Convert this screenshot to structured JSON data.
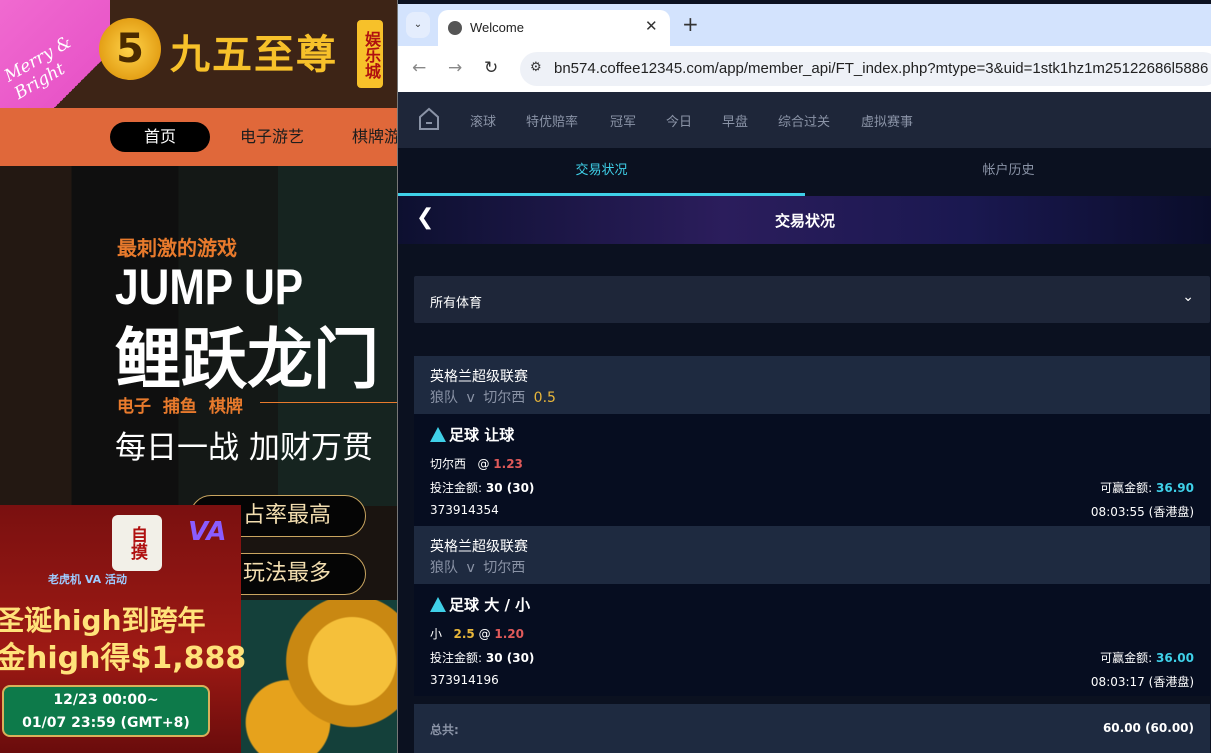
{
  "background_site": {
    "xmas_sticker": "Merry & Bright",
    "logo_mark": "5",
    "logo_text": "九五至尊",
    "logo_badge": "娱乐城",
    "nav": [
      "首页",
      "电子游艺",
      "棋牌游"
    ],
    "hero": {
      "tagline": "最刺激的游戏",
      "headline_en": "JUMP UP",
      "headline_cn": "鲤跃龙门",
      "categories": "电子 捕鱼 棋牌",
      "slogan": "每日一战 加财万贯",
      "pill1": "占率最高",
      "pill2": "玩法最多"
    },
    "promo": {
      "tile": "自摸",
      "brand": "VA",
      "subtitle": "老虎机 VA 活动",
      "line1": "圣诞high到跨年",
      "line2": "金high得$1,888",
      "date1": "12/23 00:00~",
      "date2": "01/07 23:59 (GMT+8)"
    }
  },
  "browser": {
    "tab_title": "Welcome",
    "url": "bn574.coffee12345.com/app/member_api/FT_index.php?mtype=3&uid=1stk1hz1m25122686l5886"
  },
  "sports_nav": [
    "滚球",
    "特优赔率",
    "冠军",
    "今日",
    "早盘",
    "综合过关",
    "虚拟赛事"
  ],
  "tabs": [
    "交易状况",
    "帐户历史"
  ],
  "header_title": "交易状况",
  "sport_filter": "所有体育",
  "labels": {
    "stake": "投注金额:",
    "win": "可赢金额:",
    "total": "总共:"
  },
  "bets": [
    {
      "league": "英格兰超级联赛",
      "home": "狼队",
      "vs": "v",
      "away": "切尔西",
      "handicap": "0.5",
      "bet_type": "足球 让球",
      "selection": "切尔西",
      "line": "",
      "at": "@",
      "odds": "1.23",
      "stake": "30 (30)",
      "to_win": "36.90",
      "ticket": "373914354",
      "time": "08:03:55 (香港盘)"
    },
    {
      "league": "英格兰超级联赛",
      "home": "狼队",
      "vs": "v",
      "away": "切尔西",
      "handicap": "",
      "bet_type": "足球 大 / 小",
      "selection": "小",
      "line": "2.5",
      "at": "@",
      "odds": "1.20",
      "stake": "30 (30)",
      "to_win": "36.00",
      "ticket": "373914196",
      "time": "08:03:17 (香港盘)"
    }
  ],
  "total": "60.00 (60.00)"
}
